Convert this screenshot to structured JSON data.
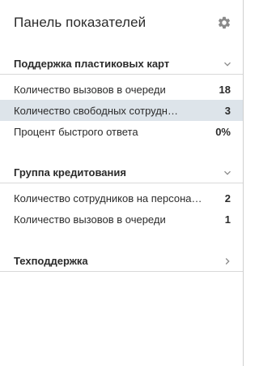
{
  "header": {
    "title": "Панель показателей",
    "settings_icon": "gear-icon"
  },
  "sections": [
    {
      "title": "Поддержка пластиковых карт",
      "state": "expanded",
      "rows": [
        {
          "label": "Количество вызовов в очереди",
          "value": "18",
          "selected": false
        },
        {
          "label": "Количество свободных сотрудн…",
          "value": "3",
          "selected": true
        },
        {
          "label": "Процент быстрого ответа",
          "value": "0%",
          "selected": false
        }
      ]
    },
    {
      "title": "Группа кредитования",
      "state": "expanded",
      "rows": [
        {
          "label": "Количество сотрудников на персона…",
          "value": "2",
          "selected": false
        },
        {
          "label": "Количество вызовов в очереди",
          "value": "1",
          "selected": false
        }
      ]
    },
    {
      "title": "Техподдержка",
      "state": "collapsed",
      "rows": []
    }
  ],
  "colors": {
    "selected_row": "#dde4ea",
    "text": "#2b2b2b",
    "icon": "#8a8a8a"
  }
}
